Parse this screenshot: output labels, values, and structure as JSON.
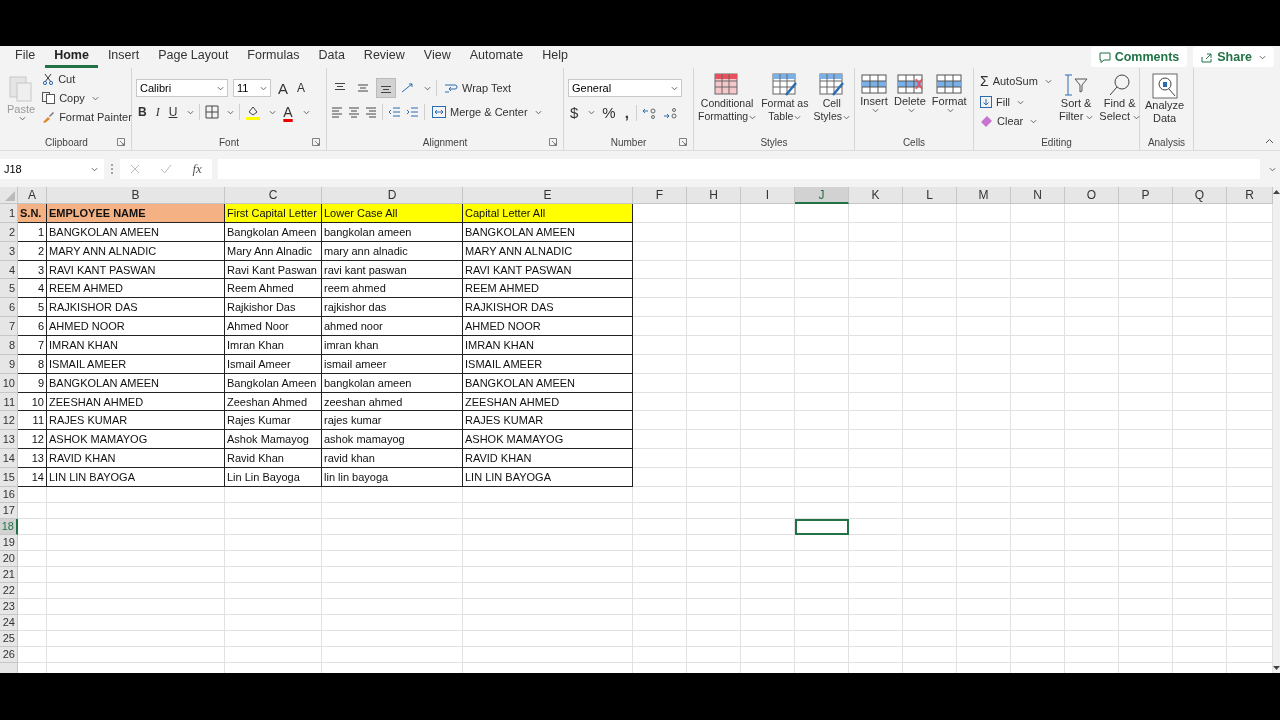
{
  "tabs": [
    {
      "label": "File",
      "selected": false
    },
    {
      "label": "Home",
      "selected": true
    },
    {
      "label": "Insert",
      "selected": false
    },
    {
      "label": "Page Layout",
      "selected": false
    },
    {
      "label": "Formulas",
      "selected": false
    },
    {
      "label": "Data",
      "selected": false
    },
    {
      "label": "Review",
      "selected": false
    },
    {
      "label": "View",
      "selected": false
    },
    {
      "label": "Automate",
      "selected": false
    },
    {
      "label": "Help",
      "selected": false
    }
  ],
  "top_buttons": {
    "comments": "Comments",
    "share": "Share"
  },
  "ribbon": {
    "clipboard": {
      "label": "Clipboard",
      "paste": {
        "label": "Paste",
        "disabled": true
      },
      "cut": "Cut",
      "copy": "Copy",
      "format_painter": "Format Painter"
    },
    "font": {
      "label": "Font",
      "family": "Calibri",
      "size": "11",
      "grow": "A",
      "shrink": "A",
      "bold": "B",
      "italic": "I",
      "underline": "U",
      "font_color": "A"
    },
    "alignment": {
      "label": "Alignment",
      "wrap_text": "Wrap Text",
      "merge": "Merge & Center",
      "vertical_align": [
        {
          "selected": false
        },
        {
          "selected": false
        },
        {
          "selected": true
        }
      ]
    },
    "number": {
      "label": "Number",
      "format": "General",
      "currency": "$",
      "percent": "%",
      "comma": ","
    },
    "styles": {
      "label": "Styles",
      "buttons": [
        [
          "Conditional",
          "Formatting"
        ],
        [
          "Format as",
          "Table"
        ],
        [
          "Cell",
          "Styles"
        ]
      ]
    },
    "cells": {
      "label": "Cells",
      "buttons": [
        "Insert",
        "Delete",
        "Format"
      ]
    },
    "editing": {
      "label": "Editing",
      "sigma": "Σ",
      "autosum": "AutoSum",
      "fill": "Fill",
      "clear": "Clear",
      "sort": [
        "Sort &",
        "Filter"
      ],
      "find": [
        "Find &",
        "Select"
      ]
    },
    "analysis": {
      "label": "Analysis",
      "analyze": [
        "Analyze",
        "Data"
      ]
    }
  },
  "formula_bar": {
    "name_box": "J18",
    "fx": "fx"
  },
  "sheet": {
    "columns": [
      {
        "label": "A",
        "selected": false
      },
      {
        "label": "B",
        "selected": false
      },
      {
        "label": "C",
        "selected": false
      },
      {
        "label": "D",
        "selected": false
      },
      {
        "label": "E",
        "selected": false
      },
      {
        "label": "F",
        "selected": false
      },
      {
        "label": "H",
        "selected": false
      },
      {
        "label": "I",
        "selected": false
      },
      {
        "label": "J",
        "selected": true
      },
      {
        "label": "K",
        "selected": false
      },
      {
        "label": "L",
        "selected": false
      },
      {
        "label": "M",
        "selected": false
      },
      {
        "label": "N",
        "selected": false
      },
      {
        "label": "O",
        "selected": false
      },
      {
        "label": "P",
        "selected": false
      },
      {
        "label": "Q",
        "selected": false
      },
      {
        "label": "R",
        "selected": false
      }
    ],
    "rows": [
      {
        "number": "1",
        "kind": "header",
        "selected": false,
        "cells": [
          {
            "text": "S.N.",
            "color": "#f4b183",
            "bold": true
          },
          {
            "text": "EMPLOYEE NAME",
            "color": "#f4b183",
            "bold": true
          },
          {
            "text": "First Capital Letter",
            "color": "#ffff00",
            "bold": false
          },
          {
            "text": "Lower Case All",
            "color": "#ffff00",
            "bold": false
          },
          {
            "text": "Capital Letter All",
            "color": "#ffff00",
            "bold": false
          }
        ]
      },
      {
        "number": "2",
        "kind": "data",
        "selected": false,
        "cells": [
          "1",
          "BANGKOLAN AMEEN",
          "Bangkolan Ameen",
          "bangkolan ameen",
          "BANGKOLAN AMEEN"
        ]
      },
      {
        "number": "3",
        "kind": "data",
        "selected": false,
        "cells": [
          "2",
          "MARY ANN ALNADIC",
          "Mary Ann Alnadic",
          "mary ann alnadic",
          "MARY ANN ALNADIC"
        ]
      },
      {
        "number": "4",
        "kind": "data",
        "selected": false,
        "cells": [
          "3",
          "RAVI KANT PASWAN",
          "Ravi Kant Paswan",
          "ravi kant paswan",
          "RAVI KANT PASWAN"
        ]
      },
      {
        "number": "5",
        "kind": "data",
        "selected": false,
        "cells": [
          "4",
          "REEM AHMED",
          "Reem Ahmed",
          "reem ahmed",
          "REEM AHMED"
        ]
      },
      {
        "number": "6",
        "kind": "data",
        "selected": false,
        "cells": [
          "5",
          "RAJKISHOR DAS",
          "Rajkishor Das",
          "rajkishor das",
          "RAJKISHOR DAS"
        ]
      },
      {
        "number": "7",
        "kind": "data",
        "selected": false,
        "cells": [
          "6",
          "AHMED NOOR",
          "Ahmed Noor",
          "ahmed noor",
          "AHMED NOOR"
        ]
      },
      {
        "number": "8",
        "kind": "data",
        "selected": false,
        "cells": [
          "7",
          "IMRAN KHAN",
          "Imran Khan",
          "imran khan",
          "IMRAN KHAN"
        ]
      },
      {
        "number": "9",
        "kind": "data",
        "selected": false,
        "cells": [
          "8",
          "ISMAIL AMEER",
          "Ismail Ameer",
          "ismail ameer",
          "ISMAIL AMEER"
        ]
      },
      {
        "number": "10",
        "kind": "data",
        "selected": false,
        "cells": [
          "9",
          "BANGKOLAN AMEEN",
          "Bangkolan Ameen",
          "bangkolan ameen",
          "BANGKOLAN AMEEN"
        ]
      },
      {
        "number": "11",
        "kind": "data",
        "selected": false,
        "cells": [
          "10",
          "ZEESHAN AHMED",
          "Zeeshan Ahmed",
          "zeeshan ahmed",
          "ZEESHAN AHMED"
        ]
      },
      {
        "number": "12",
        "kind": "data",
        "selected": false,
        "cells": [
          "11",
          "RAJES KUMAR",
          "Rajes Kumar",
          "rajes kumar",
          "RAJES KUMAR"
        ]
      },
      {
        "number": "13",
        "kind": "data",
        "selected": false,
        "cells": [
          "12",
          "ASHOK MAMAYOG",
          "Ashok Mamayog",
          "ashok mamayog",
          "ASHOK MAMAYOG"
        ]
      },
      {
        "number": "14",
        "kind": "data",
        "selected": false,
        "cells": [
          "13",
          "RAVID KHAN",
          "Ravid Khan",
          "ravid khan",
          "RAVID KHAN"
        ]
      },
      {
        "number": "15",
        "kind": "data",
        "selected": false,
        "cells": [
          "14",
          "LIN LIN BAYOGA",
          "Lin Lin Bayoga",
          "lin lin bayoga",
          "LIN LIN BAYOGA"
        ]
      },
      {
        "number": "16",
        "kind": "empty",
        "selected": false
      },
      {
        "number": "17",
        "kind": "empty",
        "selected": false
      },
      {
        "number": "18",
        "kind": "empty",
        "selected": true
      },
      {
        "number": "19",
        "kind": "empty",
        "selected": false
      },
      {
        "number": "20",
        "kind": "empty",
        "selected": false
      },
      {
        "number": "21",
        "kind": "empty",
        "selected": false
      },
      {
        "number": "22",
        "kind": "empty",
        "selected": false
      },
      {
        "number": "23",
        "kind": "empty",
        "selected": false
      },
      {
        "number": "24",
        "kind": "empty",
        "selected": false
      },
      {
        "number": "25",
        "kind": "empty",
        "selected": false
      },
      {
        "number": "26",
        "kind": "empty",
        "selected": false
      }
    ]
  }
}
